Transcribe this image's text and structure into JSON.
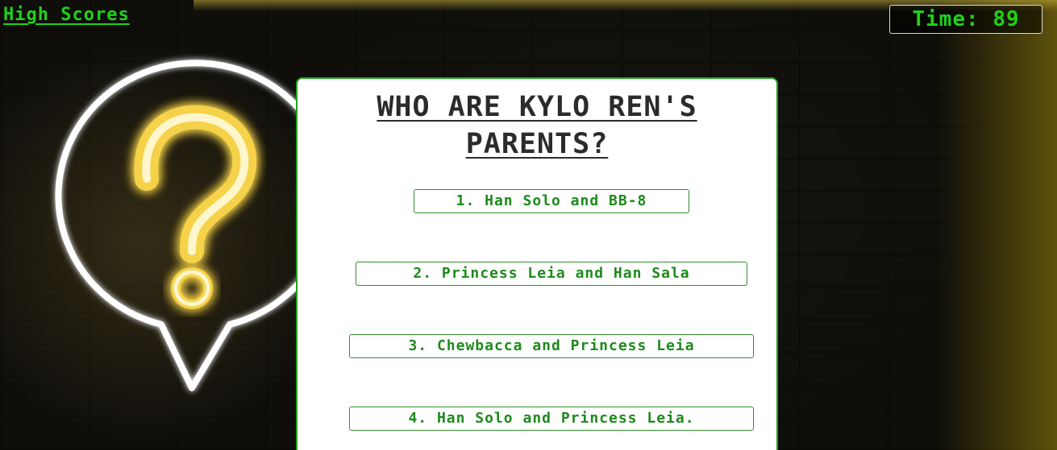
{
  "header": {
    "high_scores_label": "High Scores",
    "timer_label": "Time:",
    "timer_value": "89"
  },
  "quiz": {
    "question": "WHO ARE KYLO REN'S PARENTS?",
    "choices": [
      {
        "label": "1. Han Solo and BB-8"
      },
      {
        "label": "2. Princess Leia and Han Sala"
      },
      {
        "label": "3. Chewbacca and Princess Leia"
      },
      {
        "label": "4. Han Solo and Princess Leia."
      }
    ]
  },
  "colors": {
    "accent_green": "#1fd11a",
    "card_border": "#22a31f",
    "neon_glow": "#f5d24a",
    "neon_white": "#ffffff"
  },
  "icons": {
    "background_sign": "question-mark-speech-bubble-icon"
  }
}
